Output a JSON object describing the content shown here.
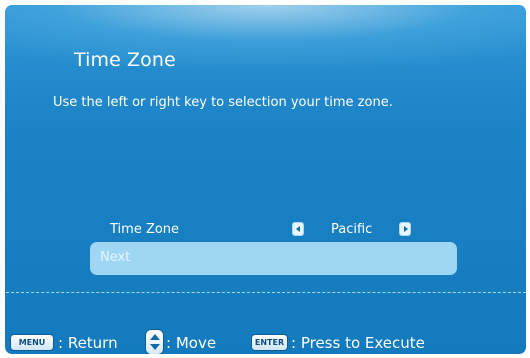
{
  "screen": {
    "title": "Time Zone",
    "description": "Use the left or right key to selection your time zone."
  },
  "setting": {
    "label": "Time Zone",
    "value": "Pacific",
    "left_icon": "left-arrow-icon",
    "right_icon": "right-arrow-icon"
  },
  "next_button": {
    "label": "Next"
  },
  "footer": {
    "menu_key": "MENU",
    "menu_text": ": Return",
    "move_icon": "up-down-key-icon",
    "move_text": ": Move",
    "enter_key": "ENTER",
    "enter_text": ": Press to Execute"
  },
  "colors": {
    "background": "#1b83c6",
    "highlight": "#9fd6f4",
    "text": "#ffffff"
  }
}
